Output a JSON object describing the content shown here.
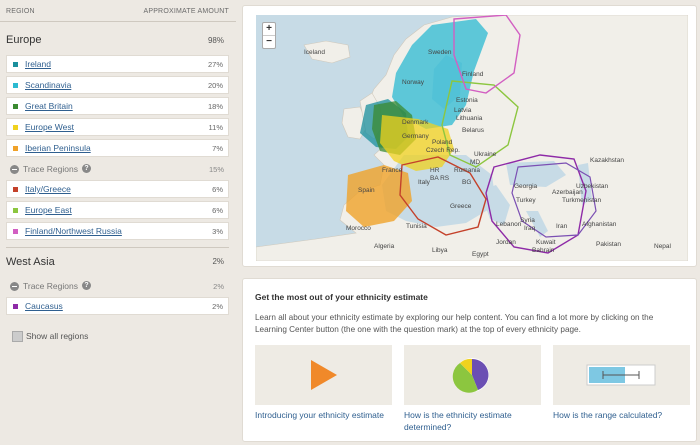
{
  "columns": {
    "region": "REGION",
    "amount": "APPROXIMATE AMOUNT"
  },
  "europe": {
    "title": "Europe",
    "pct": "98%",
    "items": [
      {
        "name": "Ireland",
        "pct": "27%",
        "color": "#1a8f9c"
      },
      {
        "name": "Scandinavia",
        "pct": "20%",
        "color": "#2bbad1"
      },
      {
        "name": "Great Britain",
        "pct": "18%",
        "color": "#3a8a30"
      },
      {
        "name": "Europe West",
        "pct": "11%",
        "color": "#f0d21e"
      },
      {
        "name": "Iberian Peninsula",
        "pct": "7%",
        "color": "#f0a229"
      }
    ],
    "trace": {
      "label": "Trace Regions",
      "pct": "15%"
    },
    "trace_items": [
      {
        "name": "Italy/Greece",
        "pct": "6%",
        "color": "#c4412a"
      },
      {
        "name": "Europe East",
        "pct": "6%",
        "color": "#8cc63f"
      },
      {
        "name": "Finland/Northwest Russia",
        "pct": "3%",
        "color": "#d25fc2"
      }
    ]
  },
  "west_asia": {
    "title": "West Asia",
    "pct": "2%",
    "trace": {
      "label": "Trace Regions",
      "pct": "2%"
    },
    "trace_items": [
      {
        "name": "Caucasus",
        "pct": "2%",
        "color": "#8e2aa7"
      }
    ]
  },
  "show_all": "Show all regions",
  "map": {
    "zoom_in": "+",
    "zoom_out": "−",
    "labels": [
      "Iceland",
      "Sweden",
      "Finland",
      "Norway",
      "Estonia",
      "Latvia",
      "Lithuania",
      "Denmark",
      "Belarus",
      "Germany",
      "Poland",
      "Ukraine",
      "Kazakhstan",
      "Czech Rep.",
      "MD",
      "HR",
      "BA RS",
      "Romania",
      "BG",
      "France",
      "Italy",
      "Spain",
      "Greece",
      "Georgia",
      "Uzbekistan",
      "Azerbaijan",
      "Turkmenistan",
      "Turkey",
      "Syria",
      "Lebanon",
      "Iraq",
      "Iran",
      "Afghanistan",
      "Morocco",
      "Tunisia",
      "Jordan",
      "Kuwait",
      "Bahrain",
      "Pakistan",
      "Nepal",
      "Algeria",
      "Libya",
      "Egypt"
    ]
  },
  "info": {
    "heading": "Get the most out of your ethnicity estimate",
    "body": "Learn all about your ethnicity estimate by exploring our help content. You can find a lot more by clicking on the Learning Center button (the one with the question mark) at the top of every ethnicity page.",
    "cards": [
      {
        "label": "Introducing your ethnicity estimate"
      },
      {
        "label": "How is the ethnicity estimate determined?"
      },
      {
        "label": "How is the range calculated?"
      }
    ]
  }
}
